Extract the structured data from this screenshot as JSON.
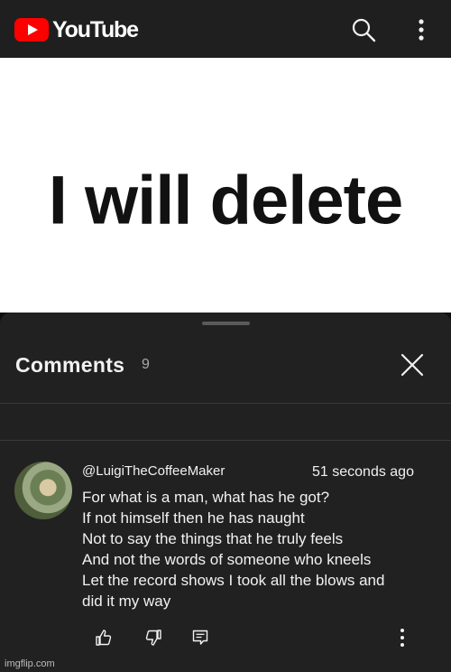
{
  "header": {
    "logo_text": "YouTube",
    "logo_color": "#ff0000",
    "search_icon": "search-icon",
    "menu_icon": "more-vertical-icon"
  },
  "video": {
    "overlay_text": "I will delete"
  },
  "comments_panel": {
    "title": "Comments",
    "count": "9",
    "close_icon": "close-icon",
    "comment": {
      "author": "@LuigiTheCoffeeMaker",
      "timestamp": "51 seconds ago",
      "lines": [
        "For what is a man, what has he got?",
        "If not himself then he has naught",
        "Not to say the things that he truly feels",
        "And not the words of someone who kneels",
        "Let the record shows I took all the blows and",
        "did it my way"
      ],
      "actions": [
        "like-icon",
        "dislike-icon",
        "reply-icon",
        "more-vertical-icon"
      ]
    }
  },
  "watermark": "imgflip.com"
}
